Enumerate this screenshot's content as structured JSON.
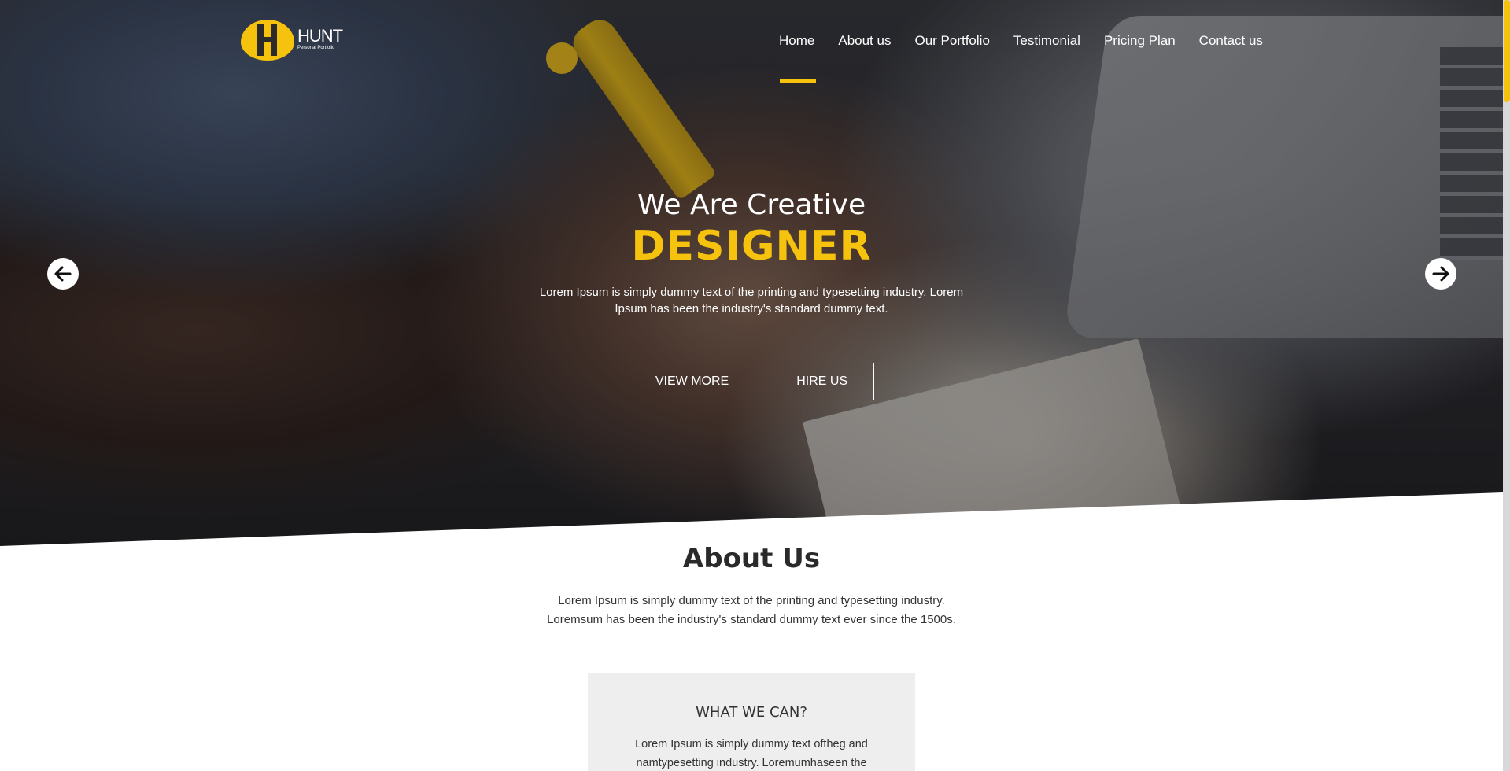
{
  "logo": {
    "name": "HUNT",
    "tagline": "Personal Portfolio"
  },
  "nav": {
    "items": [
      {
        "label": "Home"
      },
      {
        "label": "About us"
      },
      {
        "label": "Our Portfolio"
      },
      {
        "label": "Testimonial"
      },
      {
        "label": "Pricing Plan"
      },
      {
        "label": "Contact us"
      }
    ],
    "active": "Home"
  },
  "hero": {
    "kicker": "We Are Creative",
    "title": "DESIGNER",
    "description": "Lorem Ipsum is simply dummy text of the printing and typesetting industry. Lorem Ipsum has been the industry's standard dummy text.",
    "view_more": "VIEW MORE",
    "hire_us": "HIRE US",
    "prev_icon": "arrow-left-icon",
    "next_icon": "arrow-right-icon"
  },
  "about": {
    "title": "About Us",
    "line1": "Lorem Ipsum is simply dummy text of the printing and typesetting industry.",
    "line2": "Loremsum has been the industry's standard dummy text ever since the 1500s."
  },
  "card": {
    "title": "WHAT WE CAN?",
    "line1": "Lorem Ipsum is simply dummy text oftheg and",
    "line2": "namtypesetting industry. Loremumhaseen the"
  },
  "colors": {
    "accent": "#f5c20d",
    "card_bg": "#eeeeee"
  }
}
